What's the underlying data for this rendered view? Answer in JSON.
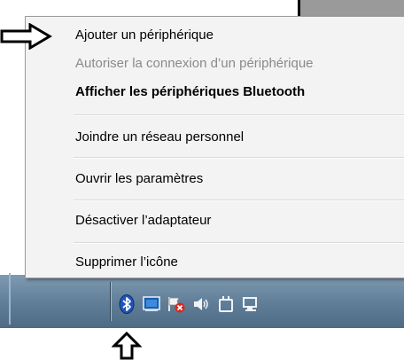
{
  "menu": {
    "items": [
      {
        "label": "Ajouter un périphérique",
        "enabled": true,
        "bold": false
      },
      {
        "label": "Autoriser la connexion d’un périphérique",
        "enabled": false,
        "bold": false
      },
      {
        "label": "Afficher les périphériques Bluetooth",
        "enabled": true,
        "bold": true
      },
      {
        "label": "Joindre un réseau personnel",
        "enabled": true,
        "bold": false
      },
      {
        "label": "Ouvrir les paramètres",
        "enabled": true,
        "bold": false
      },
      {
        "label": "Désactiver l’adaptateur",
        "enabled": true,
        "bold": false
      },
      {
        "label": "Supprimer l’icône",
        "enabled": true,
        "bold": false
      }
    ]
  },
  "tray": {
    "icons": [
      "bluetooth-icon",
      "action-center-icon",
      "network-error-icon",
      "volume-icon",
      "power-icon",
      "display-icon"
    ]
  },
  "colors": {
    "taskbar": "#5f7d97",
    "menu_background": "#f3f3f3",
    "bluetooth": "#1f55b8"
  }
}
